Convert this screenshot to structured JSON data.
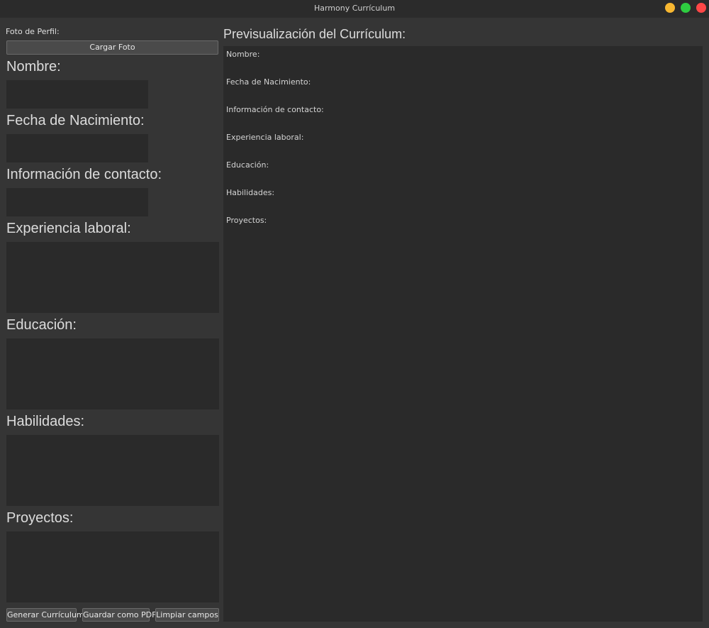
{
  "window": {
    "title": "Harmony Currículum"
  },
  "profile": {
    "label": "Foto de Perfil:",
    "upload_button": "Cargar Foto"
  },
  "form": {
    "name_label": "Nombre:",
    "birth_label": "Fecha de Nacimiento:",
    "contact_label": "Información de contacto:",
    "experience_label": "Experiencia laboral:",
    "education_label": "Educación:",
    "skills_label": "Habilidades:",
    "projects_label": "Proyectos:"
  },
  "actions": {
    "generate": "Generar Currículum",
    "save_pdf": "Guardar como PDF",
    "clear": "Limpiar campos"
  },
  "preview": {
    "title": "Previsualización del Currículum:",
    "lines": [
      "Nombre:",
      "Fecha de Nacimiento:",
      "Información de contacto:",
      "Experiencia laboral:",
      "Educación:",
      "Habilidades:",
      "Proyectos:"
    ]
  },
  "colors": {
    "close": "#ff4747",
    "minimize": "#f7b731",
    "maximize": "#2ecc40"
  }
}
